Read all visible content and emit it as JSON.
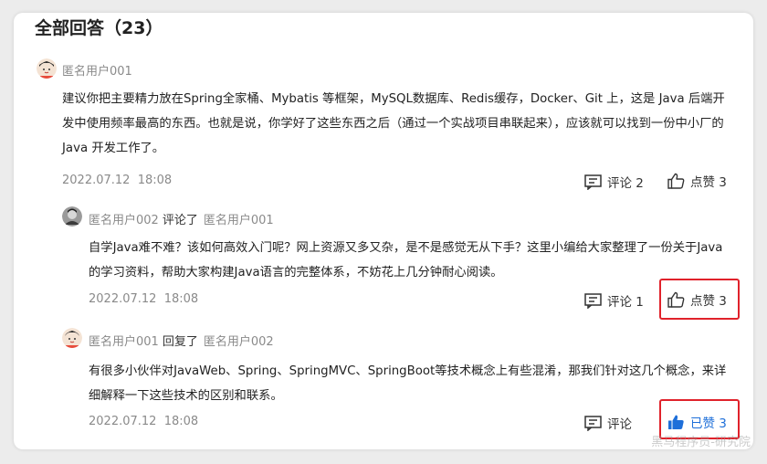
{
  "header": {
    "title": "全部回答（23）"
  },
  "comments": [
    {
      "user": "匿名用户001",
      "text": "建议你把主要精力放在Spring全家桶、Mybatis 等框架，MySQL数据库、Redis缓存，Docker、Git 上，这是 Java 后端开发中使用频率最高的东西。也就是说，你学好了这些东西之后（通过一个实战项目串联起来），应该就可以找到一份中小厂的 Java 开发工作了。",
      "date": "2022.07.12",
      "time": "18:08",
      "comment_label": "评论 2",
      "like_label": "点赞 3"
    },
    {
      "user": "匿名用户002",
      "action": "评论了",
      "target": "匿名用户001",
      "text": "自学Java难不难？该如何高效入门呢？网上资源又多又杂，是不是感觉无从下手？这里小编给大家整理了一份关于Java的学习资料，帮助大家构建Java语言的完整体系，不妨花上几分钟耐心阅读。",
      "date": "2022.07.12",
      "time": "18:08",
      "comment_label": "评论 1",
      "like_label": "点赞 3"
    },
    {
      "user": "匿名用户001",
      "action": "回复了",
      "target": "匿名用户002",
      "text": "有很多小伙伴对JavaWeb、Spring、SpringMVC、SpringBoot等技术概念上有些混淆，那我们针对这几个概念，来详细解释一下这些技术的区别和联系。",
      "date": "2022.07.12",
      "time": "18:08",
      "comment_label": "评论",
      "like_label": "已赞 3"
    }
  ],
  "watermark": "黑马程序员-研究院",
  "colors": {
    "accent": "#1e6fd9",
    "highlight": "#e0222b",
    "muted": "#8a8a8a"
  }
}
